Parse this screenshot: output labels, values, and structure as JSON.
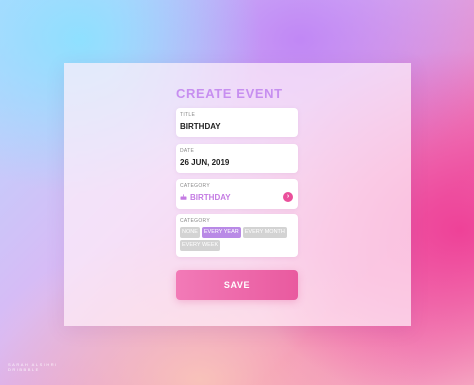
{
  "form": {
    "title": "CREATE EVENT",
    "fields": {
      "title": {
        "label": "TITLE",
        "value": "BIRTHDAY"
      },
      "date": {
        "label": "DATE",
        "value": "26 JUN, 2019"
      },
      "category": {
        "label": "CATEGORY",
        "value": "BIRTHDAY",
        "icon": "cake-icon",
        "arrow_icon": "chevron-right-icon",
        "arrow_glyph": "›"
      },
      "repeat": {
        "label": "CATEGORY",
        "options": [
          {
            "label": "NONE",
            "selected": false
          },
          {
            "label": "EVERY YEAR",
            "selected": true
          },
          {
            "label": "EVERY MONTH",
            "selected": false
          },
          {
            "label": "EVERY WEEK",
            "selected": false
          }
        ]
      }
    },
    "save_label": "SAVE"
  },
  "credit": {
    "line1": "SARAH ALSIHRI",
    "line2": "DRIBBBLE"
  },
  "colors": {
    "accent": "#c78ff0",
    "button": "#ea5a9f",
    "chip_active": "#b98ae6",
    "chip_inactive": "#d3d3d3"
  }
}
